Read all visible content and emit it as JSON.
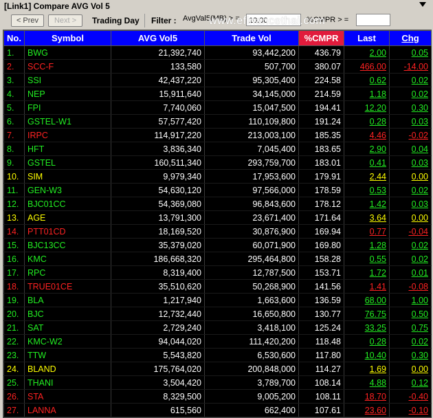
{
  "window": {
    "title": "[Link1] Compare AVG Vol 5"
  },
  "toolbar": {
    "prev_label": "< Prev",
    "next_label": "Next >",
    "trading_day_label": "Trading Day",
    "filter_label": "Filter :",
    "filter_field": "AvgVal5(MB) > =",
    "filter_value": "10.00",
    "cmpr_label": "%CMPR > =",
    "cmpr_value": "",
    "brand": "www.efinancethai.com"
  },
  "columns": [
    "No.",
    "Symbol",
    "AVG Vol5",
    "Trade Vol",
    "%CMPR",
    "Last",
    "Chg"
  ],
  "colors": {
    "header": "#0000ff",
    "cmpr_header": "#e11b3c",
    "up": "#22ee22",
    "down": "#ff2222",
    "flat": "#ffff00"
  },
  "rows": [
    {
      "no": "1.",
      "symbol": "BWG",
      "avg": "21,392,740",
      "trade": "93,442,200",
      "cmpr": "436.79",
      "last": "2.00",
      "chg": "0.05",
      "dir": "g"
    },
    {
      "no": "2.",
      "symbol": "SCC-F",
      "avg": "133,580",
      "trade": "507,700",
      "cmpr": "380.07",
      "last": "466.00",
      "chg": "-14.00",
      "dir": "r"
    },
    {
      "no": "3.",
      "symbol": "SSI",
      "avg": "42,437,220",
      "trade": "95,305,400",
      "cmpr": "224.58",
      "last": "0.62",
      "chg": "0.02",
      "dir": "g"
    },
    {
      "no": "4.",
      "symbol": "NEP",
      "avg": "15,911,640",
      "trade": "34,145,000",
      "cmpr": "214.59",
      "last": "1.18",
      "chg": "0.02",
      "dir": "g"
    },
    {
      "no": "5.",
      "symbol": "FPI",
      "avg": "7,740,060",
      "trade": "15,047,500",
      "cmpr": "194.41",
      "last": "12.20",
      "chg": "0.30",
      "dir": "g"
    },
    {
      "no": "6.",
      "symbol": "GSTEL-W1",
      "avg": "57,577,420",
      "trade": "110,109,800",
      "cmpr": "191.24",
      "last": "0.28",
      "chg": "0.03",
      "dir": "g"
    },
    {
      "no": "7.",
      "symbol": "IRPC",
      "avg": "114,917,220",
      "trade": "213,003,100",
      "cmpr": "185.35",
      "last": "4.46",
      "chg": "-0.02",
      "dir": "r"
    },
    {
      "no": "8.",
      "symbol": "HFT",
      "avg": "3,836,340",
      "trade": "7,045,400",
      "cmpr": "183.65",
      "last": "2.90",
      "chg": "0.04",
      "dir": "g"
    },
    {
      "no": "9.",
      "symbol": "GSTEL",
      "avg": "160,511,340",
      "trade": "293,759,700",
      "cmpr": "183.01",
      "last": "0.41",
      "chg": "0.03",
      "dir": "g"
    },
    {
      "no": "10.",
      "symbol": "SIM",
      "avg": "9,979,340",
      "trade": "17,953,600",
      "cmpr": "179.91",
      "last": "2.44",
      "chg": "0.00",
      "dir": "y"
    },
    {
      "no": "11.",
      "symbol": "GEN-W3",
      "avg": "54,630,120",
      "trade": "97,566,000",
      "cmpr": "178.59",
      "last": "0.53",
      "chg": "0.02",
      "dir": "g"
    },
    {
      "no": "12.",
      "symbol": "BJC01CC",
      "avg": "54,369,080",
      "trade": "96,843,600",
      "cmpr": "178.12",
      "last": "1.42",
      "chg": "0.03",
      "dir": "g"
    },
    {
      "no": "13.",
      "symbol": "AGE",
      "avg": "13,791,300",
      "trade": "23,671,400",
      "cmpr": "171.64",
      "last": "3.64",
      "chg": "0.00",
      "dir": "y"
    },
    {
      "no": "14.",
      "symbol": "PTT01CD",
      "avg": "18,169,520",
      "trade": "30,876,900",
      "cmpr": "169.94",
      "last": "0.77",
      "chg": "-0.04",
      "dir": "r"
    },
    {
      "no": "15.",
      "symbol": "BJC13CC",
      "avg": "35,379,020",
      "trade": "60,071,900",
      "cmpr": "169.80",
      "last": "1.28",
      "chg": "0.02",
      "dir": "g"
    },
    {
      "no": "16.",
      "symbol": "KMC",
      "avg": "186,668,320",
      "trade": "295,464,800",
      "cmpr": "158.28",
      "last": "0.55",
      "chg": "0.02",
      "dir": "g"
    },
    {
      "no": "17.",
      "symbol": "RPC",
      "avg": "8,319,400",
      "trade": "12,787,500",
      "cmpr": "153.71",
      "last": "1.72",
      "chg": "0.01",
      "dir": "g"
    },
    {
      "no": "18.",
      "symbol": "TRUE01CE",
      "avg": "35,510,620",
      "trade": "50,268,900",
      "cmpr": "141.56",
      "last": "1.41",
      "chg": "-0.08",
      "dir": "r"
    },
    {
      "no": "19.",
      "symbol": "BLA",
      "avg": "1,217,940",
      "trade": "1,663,600",
      "cmpr": "136.59",
      "last": "68.00",
      "chg": "1.00",
      "dir": "g"
    },
    {
      "no": "20.",
      "symbol": "BJC",
      "avg": "12,732,440",
      "trade": "16,650,800",
      "cmpr": "130.77",
      "last": "76.75",
      "chg": "0.50",
      "dir": "g"
    },
    {
      "no": "21.",
      "symbol": "SAT",
      "avg": "2,729,240",
      "trade": "3,418,100",
      "cmpr": "125.24",
      "last": "33.25",
      "chg": "0.75",
      "dir": "g"
    },
    {
      "no": "22.",
      "symbol": "KMC-W2",
      "avg": "94,044,020",
      "trade": "111,420,200",
      "cmpr": "118.48",
      "last": "0.28",
      "chg": "0.02",
      "dir": "g"
    },
    {
      "no": "23.",
      "symbol": "TTW",
      "avg": "5,543,820",
      "trade": "6,530,600",
      "cmpr": "117.80",
      "last": "10.40",
      "chg": "0.30",
      "dir": "g"
    },
    {
      "no": "24.",
      "symbol": "BLAND",
      "avg": "175,764,020",
      "trade": "200,848,000",
      "cmpr": "114.27",
      "last": "1.69",
      "chg": "0.00",
      "dir": "y"
    },
    {
      "no": "25.",
      "symbol": "THANI",
      "avg": "3,504,420",
      "trade": "3,789,700",
      "cmpr": "108.14",
      "last": "4.88",
      "chg": "0.12",
      "dir": "g"
    },
    {
      "no": "26.",
      "symbol": "STA",
      "avg": "8,329,500",
      "trade": "9,005,200",
      "cmpr": "108.11",
      "last": "18.70",
      "chg": "-0.40",
      "dir": "r"
    },
    {
      "no": "27.",
      "symbol": "LANNA",
      "avg": "615,560",
      "trade": "662,400",
      "cmpr": "107.61",
      "last": "23.60",
      "chg": "-0.10",
      "dir": "r"
    }
  ]
}
